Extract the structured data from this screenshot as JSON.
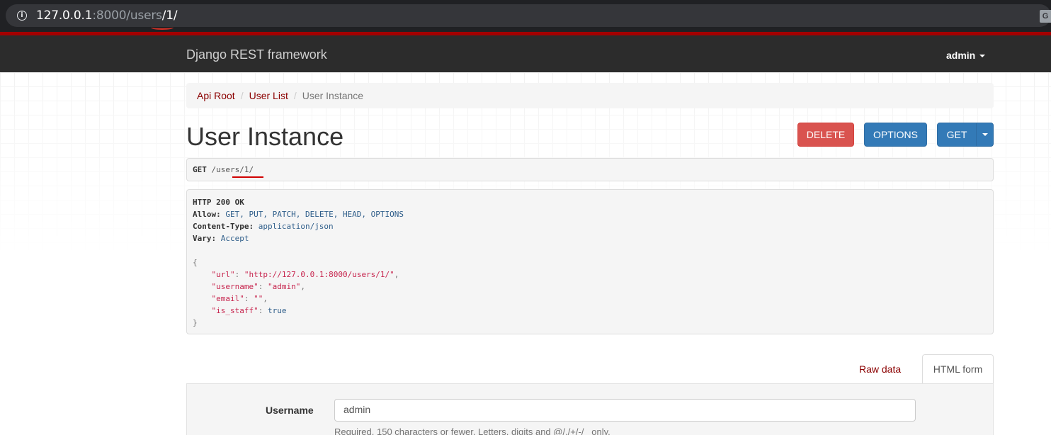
{
  "browser": {
    "url_host": "127.0.0.1",
    "url_port_path": ":8000/users",
    "url_highlight": "/1/",
    "info_glyph": "i",
    "translate_glyph": "G"
  },
  "navbar": {
    "brand": "Django REST framework",
    "user": "admin"
  },
  "breadcrumb": {
    "items": [
      "Api Root",
      "User List"
    ],
    "active": "User Instance",
    "separator": "/"
  },
  "page": {
    "title": "User Instance"
  },
  "actions": {
    "delete": "DELETE",
    "options": "OPTIONS",
    "get": "GET"
  },
  "request": {
    "method": "GET",
    "path": "/users/1/"
  },
  "response": {
    "status": "HTTP 200 OK",
    "headers": [
      {
        "key": "Allow:",
        "value": "GET, PUT, PATCH, DELETE, HEAD, OPTIONS"
      },
      {
        "key": "Content-Type:",
        "value": "application/json"
      },
      {
        "key": "Vary:",
        "value": "Accept"
      }
    ],
    "body_open": "{",
    "body_close": "}",
    "body": [
      {
        "key": "\"url\"",
        "value": "\"http://127.0.0.1:8000/users/1/\"",
        "comma": ","
      },
      {
        "key": "\"username\"",
        "value": "\"admin\"",
        "comma": ","
      },
      {
        "key": "\"email\"",
        "value": "\"\"",
        "comma": ","
      },
      {
        "key": "\"is_staff\"",
        "value": "true",
        "comma": ""
      }
    ]
  },
  "tabs": {
    "raw": "Raw data",
    "html": "HTML form"
  },
  "form": {
    "username_label": "Username",
    "username_value": "admin",
    "help": "Required. 150 characters or fewer. Letters, digits and @/./+/-/_ only."
  },
  "colors": {
    "navbar_bg": "#2c2c2c",
    "navbar_accent": "#a30000",
    "link": "#8b0000",
    "delete_btn": "#d9534f",
    "primary_btn": "#337ab7"
  }
}
